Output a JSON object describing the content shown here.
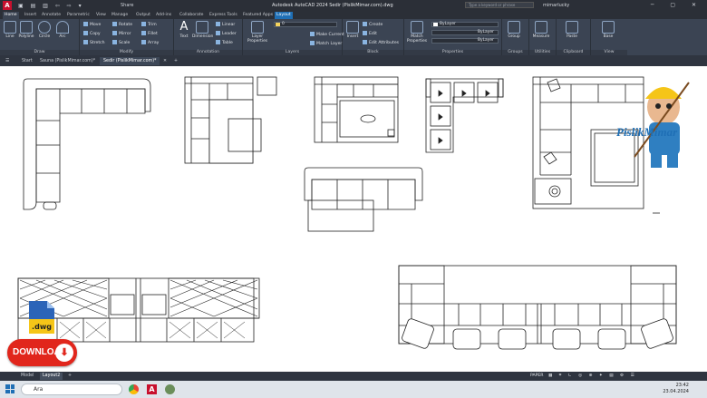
{
  "window": {
    "title": "Autodesk AutoCAD 2024   Sedir (PislikMimar.com).dwg",
    "share_label": "Share",
    "search_placeholder": "Type a keyword or phrase",
    "user": "mimarlucky"
  },
  "ribbon_tabs": [
    "Home",
    "Insert",
    "Annotate",
    "Parametric",
    "View",
    "Manage",
    "Output",
    "Add-ins",
    "Collaborate",
    "Express Tools",
    "Featured Apps",
    "Layout"
  ],
  "ribbon": {
    "draw": {
      "title": "Draw",
      "buttons": [
        "Line",
        "Polyline",
        "Circle",
        "Arc"
      ]
    },
    "modify": {
      "title": "Modify",
      "buttons": [
        "Move",
        "Rotate",
        "Trim",
        "Copy",
        "Mirror",
        "Fillet",
        "Stretch",
        "Scale",
        "Array"
      ]
    },
    "annotation": {
      "title": "Annotation",
      "buttons": [
        "Text",
        "Dimension",
        "Linear",
        "Leader",
        "Table"
      ]
    },
    "layers": {
      "title": "Layers",
      "buttons": [
        "Layer Properties",
        "Make Current",
        "Match Layer"
      ],
      "layer_value": "0"
    },
    "block": {
      "title": "Block",
      "buttons": [
        "Insert",
        "Create",
        "Edit",
        "Edit Attributes"
      ]
    },
    "properties": {
      "title": "Properties",
      "buttons": [
        "Match Properties"
      ],
      "color": "ByLayer",
      "linetype": "ByLayer",
      "lineweight": "ByLayer"
    },
    "groups": {
      "title": "Groups",
      "buttons": [
        "Group"
      ]
    },
    "utilities": {
      "title": "Utilities",
      "buttons": [
        "Measure"
      ]
    },
    "clipboard": {
      "title": "Clipboard",
      "buttons": [
        "Paste"
      ]
    },
    "view": {
      "title": "View",
      "buttons": [
        "Base"
      ]
    }
  },
  "doc_tabs": {
    "start": "Start",
    "tab1": "Sauna (PislikMimar.com)*",
    "tab2": "Sedir (PislikMimar.com)*"
  },
  "layout_tabs": {
    "model": "Model",
    "layout": "Layout2"
  },
  "status": {
    "mode": "PAPER"
  },
  "taskbar": {
    "search_placeholder": "Ara",
    "time": "23:42",
    "date": "23.04.2024"
  },
  "overlay": {
    "download_label": "DOWNLOAD",
    "file_ext": ".dwg",
    "brand": "PislikMimar"
  },
  "colors": {
    "accent": "#1f6fb5",
    "download": "#e1261c",
    "ribbon": "#3b4453"
  }
}
